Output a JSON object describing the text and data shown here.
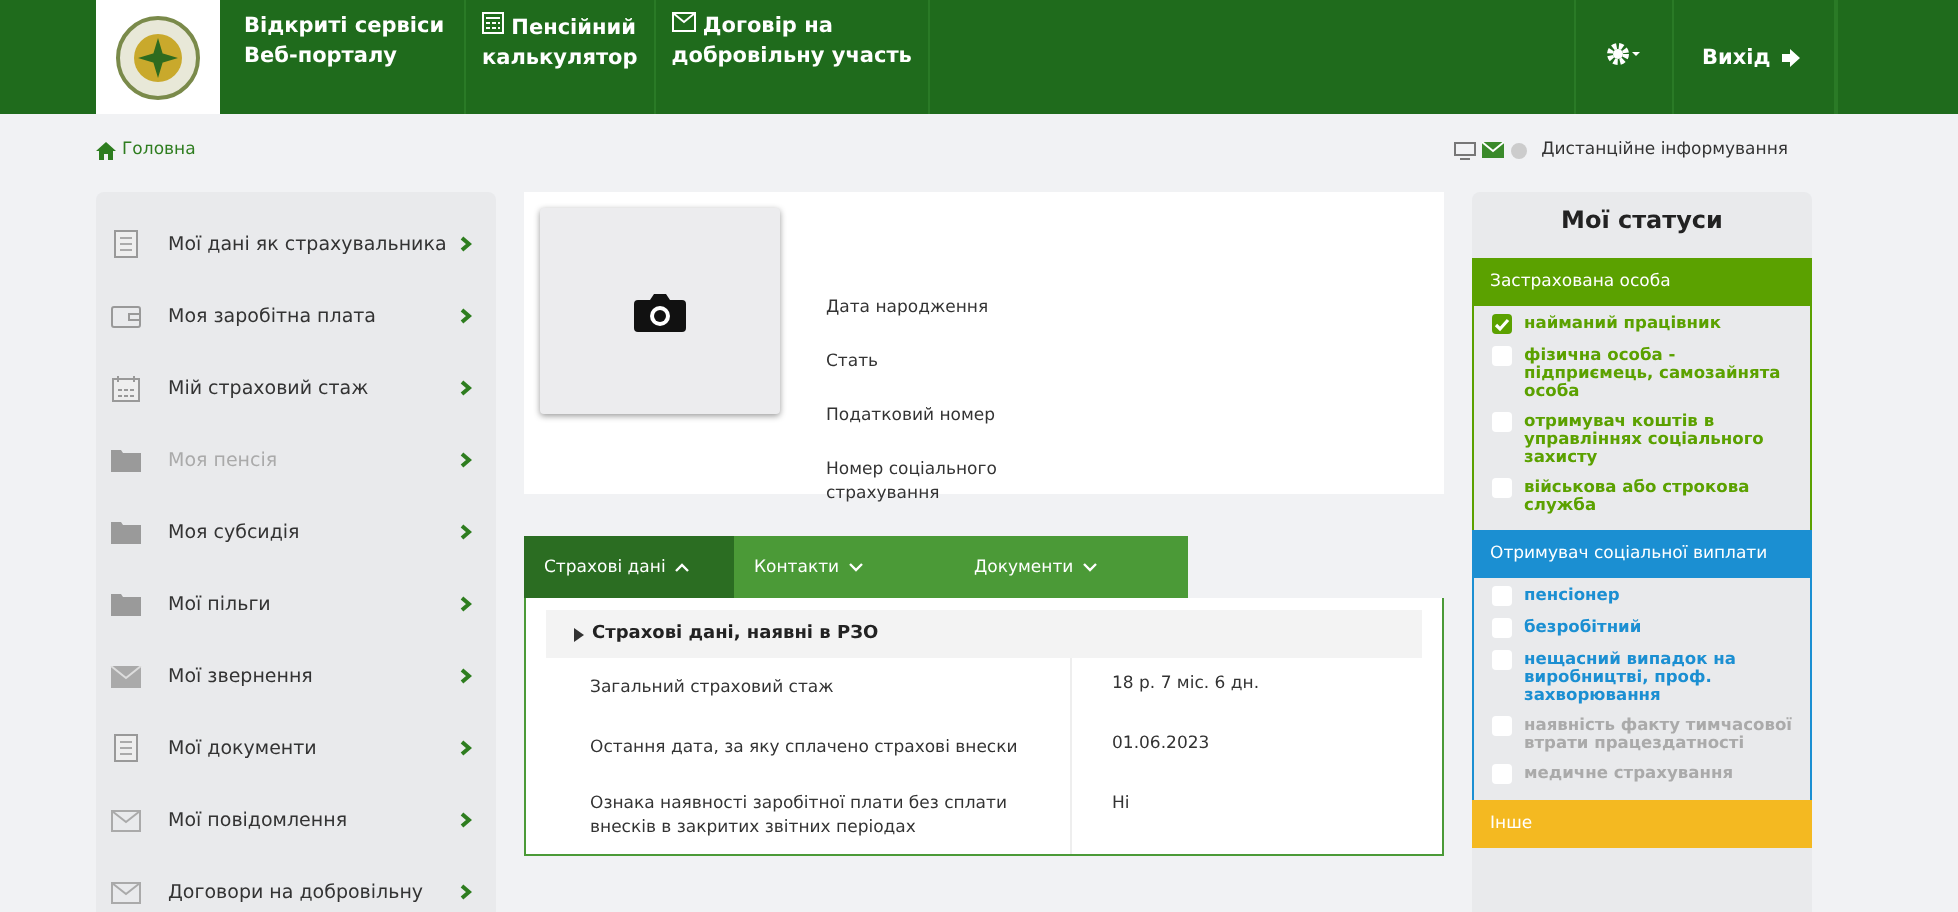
{
  "header": {
    "brand": [
      "Відкриті сервіси",
      "Веб-порталу"
    ],
    "nav": [
      {
        "kind": "calculator",
        "lines": [
          "Пенсійний",
          "калькулятор"
        ]
      },
      {
        "kind": "envelope",
        "lines": [
          "Договір на",
          "добровільну участь"
        ]
      }
    ],
    "logout": "Вихід"
  },
  "breadcrumb": "Головна",
  "remote_info": "Дистанційне інформування",
  "sidebar": {
    "items": [
      {
        "kind": "document",
        "label": "Мої дані як страхувальника",
        "disabled": false
      },
      {
        "kind": "wallet",
        "label": "Моя заробітна плата",
        "disabled": false
      },
      {
        "kind": "calendar",
        "label": "Мій страховий стаж",
        "disabled": false
      },
      {
        "kind": "folder",
        "label": "Моя пенсія",
        "disabled": true
      },
      {
        "kind": "folder",
        "label": "Моя субсидія",
        "disabled": false
      },
      {
        "kind": "folder",
        "label": "Мої пільги",
        "disabled": false
      },
      {
        "kind": "mail",
        "label": "Мої звернення",
        "disabled": false
      },
      {
        "kind": "document",
        "label": "Мої документи",
        "disabled": false
      },
      {
        "kind": "envelope",
        "label": "Мої повідомлення",
        "disabled": false
      },
      {
        "kind": "envelope",
        "label": "Договори на добровільну",
        "disabled": false
      }
    ]
  },
  "profile": {
    "fields": [
      "Дата народження",
      "Стать",
      "Податковий номер",
      "Номер соціального страхування"
    ]
  },
  "tabs": [
    {
      "label": "Страхові дані",
      "selected": true
    },
    {
      "label": "Контакти",
      "selected": false
    },
    {
      "label": "Документи",
      "selected": false
    }
  ],
  "insurance": {
    "title": "Страхові дані, наявні в РЗО",
    "rows": [
      {
        "label": "Загальний страховий стаж",
        "value": "18 р. 7 міс. 6 дн."
      },
      {
        "label": "Остання дата, за яку сплачено страхові внески",
        "value": "01.06.2023"
      },
      {
        "label": "Ознака наявності заробітної плати без сплати внесків в закритих звітних періодах",
        "value": "Ні"
      }
    ]
  },
  "statuses": {
    "title": "Мої статуси",
    "groups": [
      {
        "title": "Застрахована особа",
        "color": "#5ba100",
        "items": [
          {
            "label": "найманий працівник",
            "checked": true,
            "disabled": false
          },
          {
            "label": "фізична особа - підприємець, самозайнята особа",
            "checked": false,
            "disabled": false
          },
          {
            "label": "отримувач коштів в управліннях соціального захисту",
            "checked": false,
            "disabled": false
          },
          {
            "label": "військова або строкова служба",
            "checked": false,
            "disabled": false
          }
        ]
      },
      {
        "title": "Отримувач соціальної виплати",
        "color": "#1b8fd2",
        "items": [
          {
            "label": "пенсіонер",
            "checked": false,
            "disabled": false
          },
          {
            "label": "безробітний",
            "checked": false,
            "disabled": false
          },
          {
            "label": "нещасний випадок на виробництві, проф. захворювання",
            "checked": false,
            "disabled": false
          },
          {
            "label": "наявність факту тимчасової втрати працездатності",
            "checked": false,
            "disabled": true
          },
          {
            "label": "медичне страхування",
            "checked": false,
            "disabled": true
          }
        ]
      },
      {
        "title": "Інше",
        "color": "#f4b921"
      }
    ]
  }
}
